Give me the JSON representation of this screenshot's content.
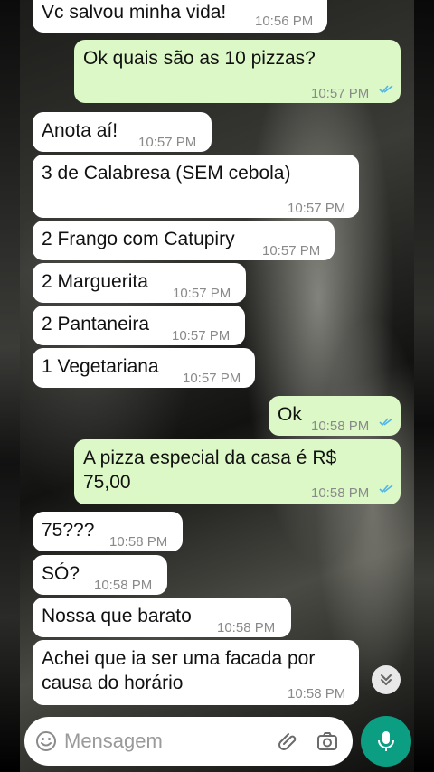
{
  "chat": {
    "messages": [
      {
        "dir": "in",
        "text": "Vc salvou minha vida!",
        "time": "10:56 PM"
      },
      {
        "dir": "out",
        "text": "Ok quais são as 10 pizzas?",
        "time": "10:57 PM",
        "status": "read"
      },
      {
        "dir": "in",
        "text": "Anota aí!",
        "time": "10:57 PM"
      },
      {
        "dir": "in",
        "text": "3 de Calabresa (SEM cebola)",
        "time": "10:57 PM"
      },
      {
        "dir": "in",
        "text": "2 Frango com Catupiry",
        "time": "10:57 PM"
      },
      {
        "dir": "in",
        "text": "2 Marguerita",
        "time": "10:57 PM"
      },
      {
        "dir": "in",
        "text": "2 Pantaneira",
        "time": "10:57 PM"
      },
      {
        "dir": "in",
        "text": "1 Vegetariana",
        "time": "10:57 PM"
      },
      {
        "dir": "out",
        "text": "Ok",
        "time": "10:58 PM",
        "status": "read"
      },
      {
        "dir": "out",
        "text": "A pizza especial da casa é R$\n75,00",
        "time": "10:58 PM",
        "status": "read"
      },
      {
        "dir": "in",
        "text": "75???",
        "time": "10:58 PM"
      },
      {
        "dir": "in",
        "text": "SÓ?",
        "time": "10:58 PM"
      },
      {
        "dir": "in",
        "text": "Nossa que barato",
        "time": "10:58 PM"
      },
      {
        "dir": "in",
        "text": "Achei que ia ser uma facada por\ncausa do horário",
        "time": "10:58 PM"
      }
    ]
  },
  "composer": {
    "placeholder": "Mensagem",
    "emoji_icon": "emoji-icon",
    "attach_icon": "paperclip-icon",
    "camera_icon": "camera-icon",
    "mic_icon": "mic-icon"
  },
  "colors": {
    "incoming_bubble": "#ffffff",
    "outgoing_bubble": "#dcf8c6",
    "read_ticks": "#4fb6ec",
    "accent": "#0c9e82"
  }
}
